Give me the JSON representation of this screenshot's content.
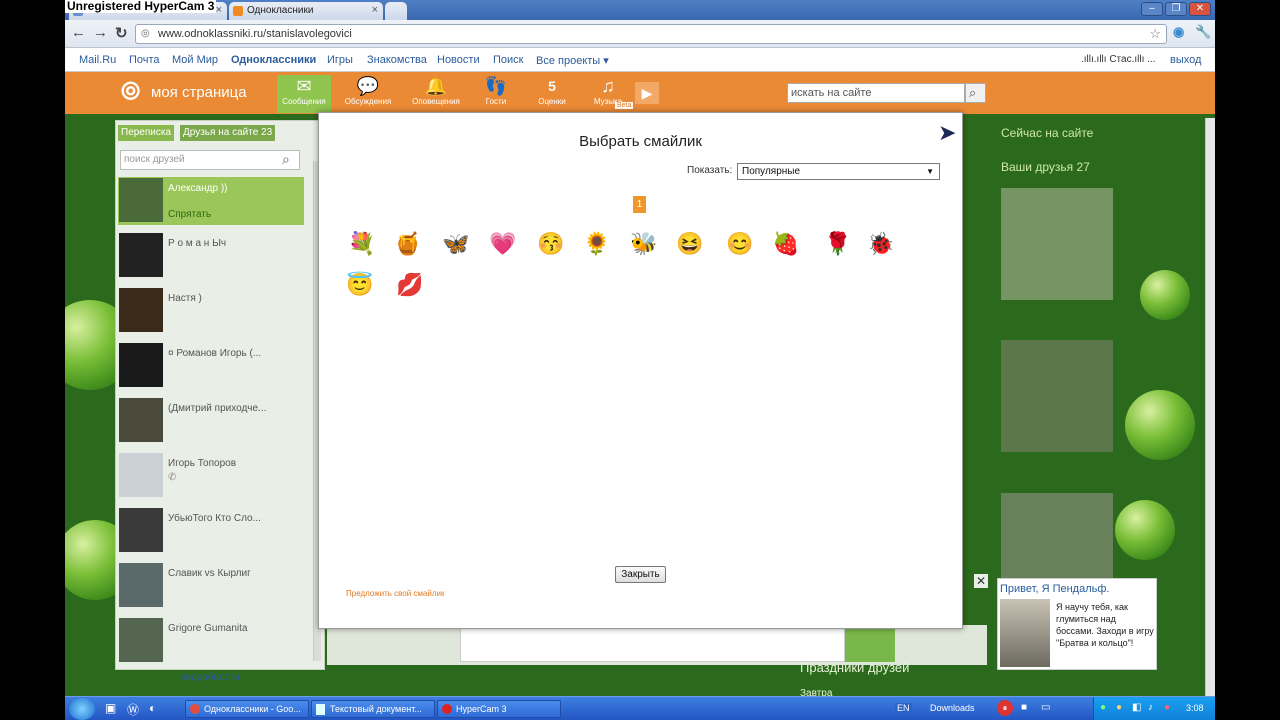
{
  "recorder": {
    "title": "Unregistered HyperCam 3"
  },
  "browser": {
    "tabs": [
      {
        "label": "Однокласники"
      }
    ],
    "url": "www.odnoklassniki.ru/stanislavolegovici"
  },
  "mailbar": {
    "links": [
      "Mail.Ru",
      "Почта",
      "Мой Мир",
      "Одноклассники",
      "Игры",
      "Знакомства",
      "Новости",
      "Поиск",
      "Все проекты ▾"
    ],
    "user": ".ıllı.ıllı Стас.ıllı ...",
    "logout": "выход"
  },
  "header": {
    "logo_text": "моя страница",
    "nav": [
      {
        "label": "Сообщения",
        "icon": "envelope-icon",
        "glyph": "✉"
      },
      {
        "label": "Обсуждения",
        "icon": "discussion-icon",
        "glyph": "💬"
      },
      {
        "label": "Оповещения",
        "icon": "bell-icon",
        "glyph": "🔔"
      },
      {
        "label": "Гости",
        "icon": "footprints-icon",
        "glyph": "👣"
      },
      {
        "label": "Оценки",
        "icon": "rating-icon",
        "glyph": "5"
      },
      {
        "label": "Музыка",
        "icon": "music-icon",
        "glyph": "♫"
      }
    ],
    "beta": "Beta",
    "search_placeholder": "искать на сайте"
  },
  "friends_panel": {
    "tab_active": "Переписка",
    "tab_other": "Друзья на сайте 23",
    "search_placeholder": "поиск друзей",
    "friends": [
      {
        "name": "Александр ))",
        "action": "Спрятать"
      },
      {
        "name": "Р о м а н Ыч"
      },
      {
        "name": "Настя )"
      },
      {
        "name": "¤ Романов Игорь (..."
      },
      {
        "name": "(Дмитрий приходче..."
      },
      {
        "name": "Игорь Топоров"
      },
      {
        "name": "УбьюТого Кто Сло..."
      },
      {
        "name": "Славик vs Кырлиг"
      },
      {
        "name": "Grigore Gumanita"
      }
    ],
    "more": "подробности"
  },
  "right_column": {
    "online_title": "Сейчас на сайте",
    "friends_title": "Ваши друзья 27",
    "holidays": "Праздники друзей",
    "tomorrow": "Завтра"
  },
  "ad": {
    "title": "Привет, Я Пендальф.",
    "text": "Я научу тебя, как глумиться над боссами. Заходи в игру \"Братва и кольцо\"!"
  },
  "modal": {
    "title": "Выбрать смайлик",
    "show_label": "Показать:",
    "show_value": "Популярные",
    "page": "1",
    "smileys": [
      "💐",
      "🍯",
      "🦋",
      "💗",
      "😚",
      "🌻",
      "🐝",
      "😆",
      "😊",
      "🍓",
      "🌹",
      "🐞",
      "😇",
      "💋"
    ],
    "close_button": "Закрыть",
    "suggest": "Предложить свой смайлик"
  },
  "taskbar": {
    "items": [
      "Одноклассники - Goo...",
      "Текстовый документ...",
      "HyperCam 3"
    ],
    "lang": "EN",
    "downloads": "Downloads",
    "clock": "3:08"
  }
}
